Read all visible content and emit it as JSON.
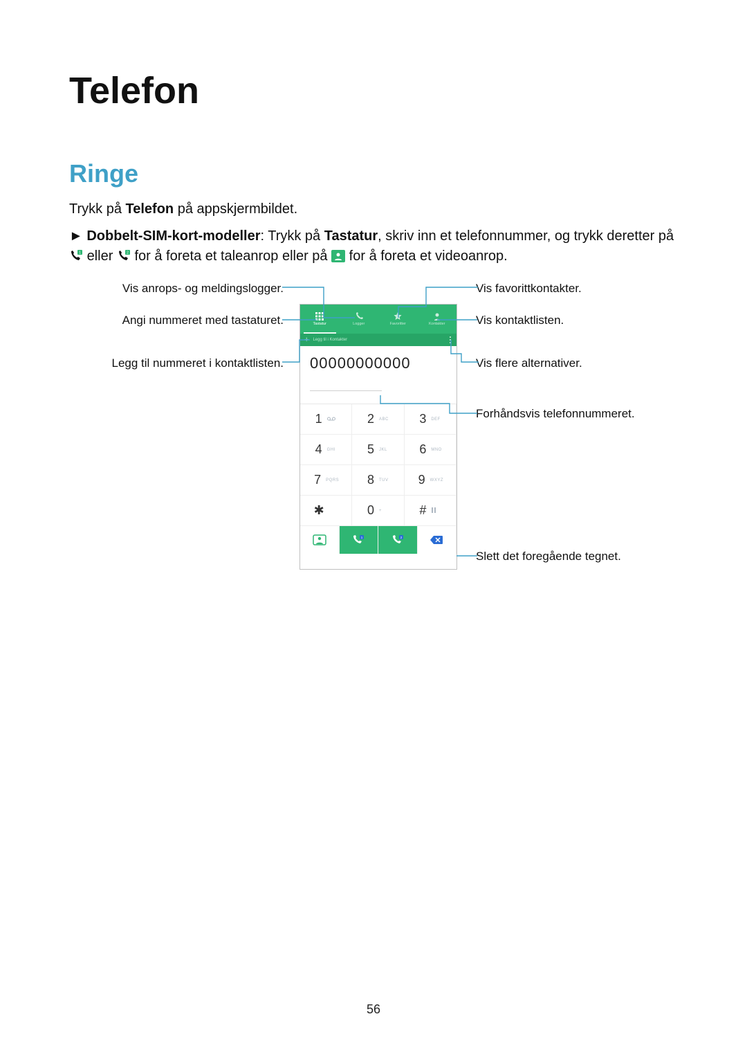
{
  "page": {
    "title": "Telefon",
    "section": "Ringe",
    "page_number": "56"
  },
  "para1": {
    "pre": "Trykk på ",
    "bold": "Telefon",
    "post": " på appskjermbildet."
  },
  "para2": {
    "arrow": "► ",
    "bold1": "Dobbelt-SIM-kort-modeller",
    "mid1": ": Trykk på ",
    "bold2": "Tastatur",
    "mid2": ", skriv inn et telefonnummer, og trykk deretter på ",
    "mid3": " eller ",
    "mid4": " for å foreta et taleanrop eller på ",
    "end": " for å foreta et videoanrop."
  },
  "phone": {
    "tabs": [
      "Tastatur",
      "Logger",
      "Favoritter",
      "Kontakter"
    ],
    "add_contact": "Legg til i Kontakter",
    "number": "00000000000",
    "keypad": [
      {
        "d": "1",
        "s": ""
      },
      {
        "d": "2",
        "s": "ABC"
      },
      {
        "d": "3",
        "s": "DEF"
      },
      {
        "d": "4",
        "s": "GHI"
      },
      {
        "d": "5",
        "s": "JKL"
      },
      {
        "d": "6",
        "s": "MNO"
      },
      {
        "d": "7",
        "s": "PQRS"
      },
      {
        "d": "8",
        "s": "TUV"
      },
      {
        "d": "9",
        "s": "WXYZ"
      },
      {
        "d": "✱",
        "s": ""
      },
      {
        "d": "0",
        "s": "+"
      },
      {
        "d": "#",
        "s": ""
      }
    ]
  },
  "callouts": {
    "left1": "Vis anrops- og meldingslogger.",
    "left2": "Angi nummeret med tastaturet.",
    "left3": "Legg til nummeret i kontaktlisten.",
    "right1": "Vis favorittkontakter.",
    "right2": "Vis kontaktlisten.",
    "right3": "Vis flere alternativer.",
    "right4": "Forhåndsvis telefonnummeret.",
    "right5": "Slett det foregående tegnet."
  }
}
